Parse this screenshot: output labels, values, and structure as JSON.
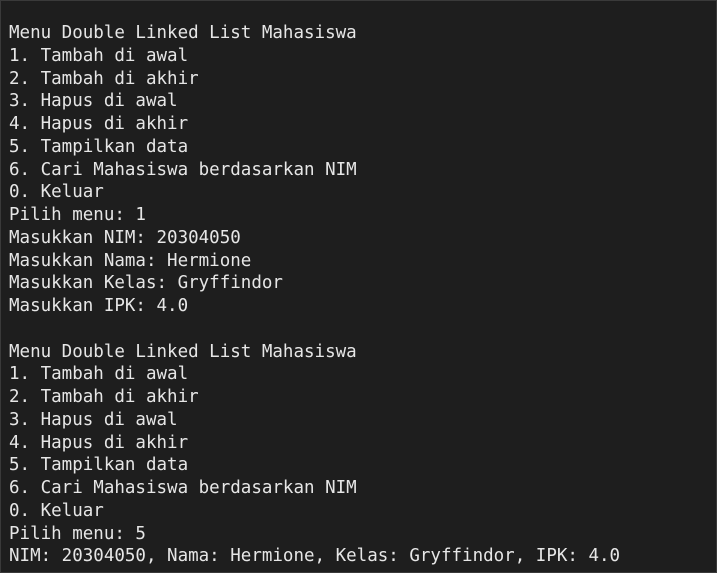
{
  "terminal": {
    "lines": [
      "Menu Double Linked List Mahasiswa",
      "1. Tambah di awal",
      "2. Tambah di akhir",
      "3. Hapus di awal",
      "4. Hapus di akhir",
      "5. Tampilkan data",
      "6. Cari Mahasiswa berdasarkan NIM",
      "0. Keluar",
      "Pilih menu: 1",
      "Masukkan NIM: 20304050",
      "Masukkan Nama: Hermione",
      "Masukkan Kelas: Gryffindor",
      "Masukkan IPK: 4.0",
      "",
      "Menu Double Linked List Mahasiswa",
      "1. Tambah di awal",
      "2. Tambah di akhir",
      "3. Hapus di awal",
      "4. Hapus di akhir",
      "5. Tampilkan data",
      "6. Cari Mahasiswa berdasarkan NIM",
      "0. Keluar",
      "Pilih menu: 5",
      "NIM: 20304050, Nama: Hermione, Kelas: Gryffindor, IPK: 4.0"
    ]
  },
  "colors": {
    "background": "#1e1e1e",
    "text": "#e6e6e6"
  }
}
